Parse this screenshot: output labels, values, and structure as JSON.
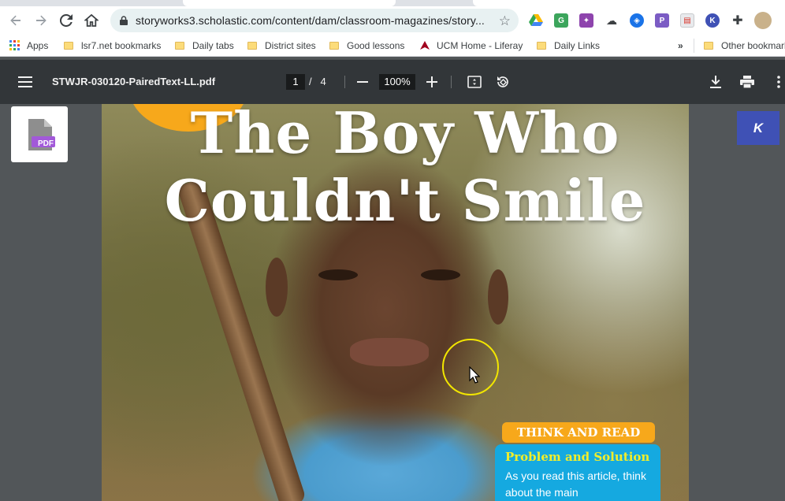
{
  "browser": {
    "url": "storyworks3.scholastic.com/content/dam/classroom-magazines/story...",
    "extensions": [
      "google-drive-icon",
      "g-extension-icon",
      "puzzle-extension-icon",
      "cloud-icon",
      "shield-icon",
      "pdf-icon",
      "calendar-icon",
      "k-extension-icon",
      "extensions-icon",
      "profile-avatar"
    ]
  },
  "bookmarks": {
    "apps_label": "Apps",
    "items": [
      "lsr7.net bookmarks",
      "Daily tabs",
      "District sites",
      "Good lessons",
      "UCM Home - Liferay",
      "Daily Links"
    ],
    "overflow": "»",
    "other": "Other bookmarks"
  },
  "pdf_toolbar": {
    "filename": "STWJR-030120-PairedText-LL.pdf",
    "current_page": "1",
    "page_sep": "/",
    "total_pages": "4",
    "zoom": "100%"
  },
  "side": {
    "pdf_badge": "PDF",
    "k_label": "K"
  },
  "document": {
    "title_line1": "The Boy Who",
    "title_line2": "Couldn't Smile",
    "think_and_read": "THINK AND READ",
    "callout_heading": "Problem and Solution",
    "callout_text": "As you read this article, think about the main"
  },
  "colors": {
    "omnibox_bg": "#e8f1f2",
    "pdf_toolbar_bg": "#323639",
    "viewer_bg": "#525659",
    "accent_orange": "#f7a81b",
    "callout_blue": "#15a9e0",
    "callout_heading_yellow": "#f2ee2a"
  }
}
